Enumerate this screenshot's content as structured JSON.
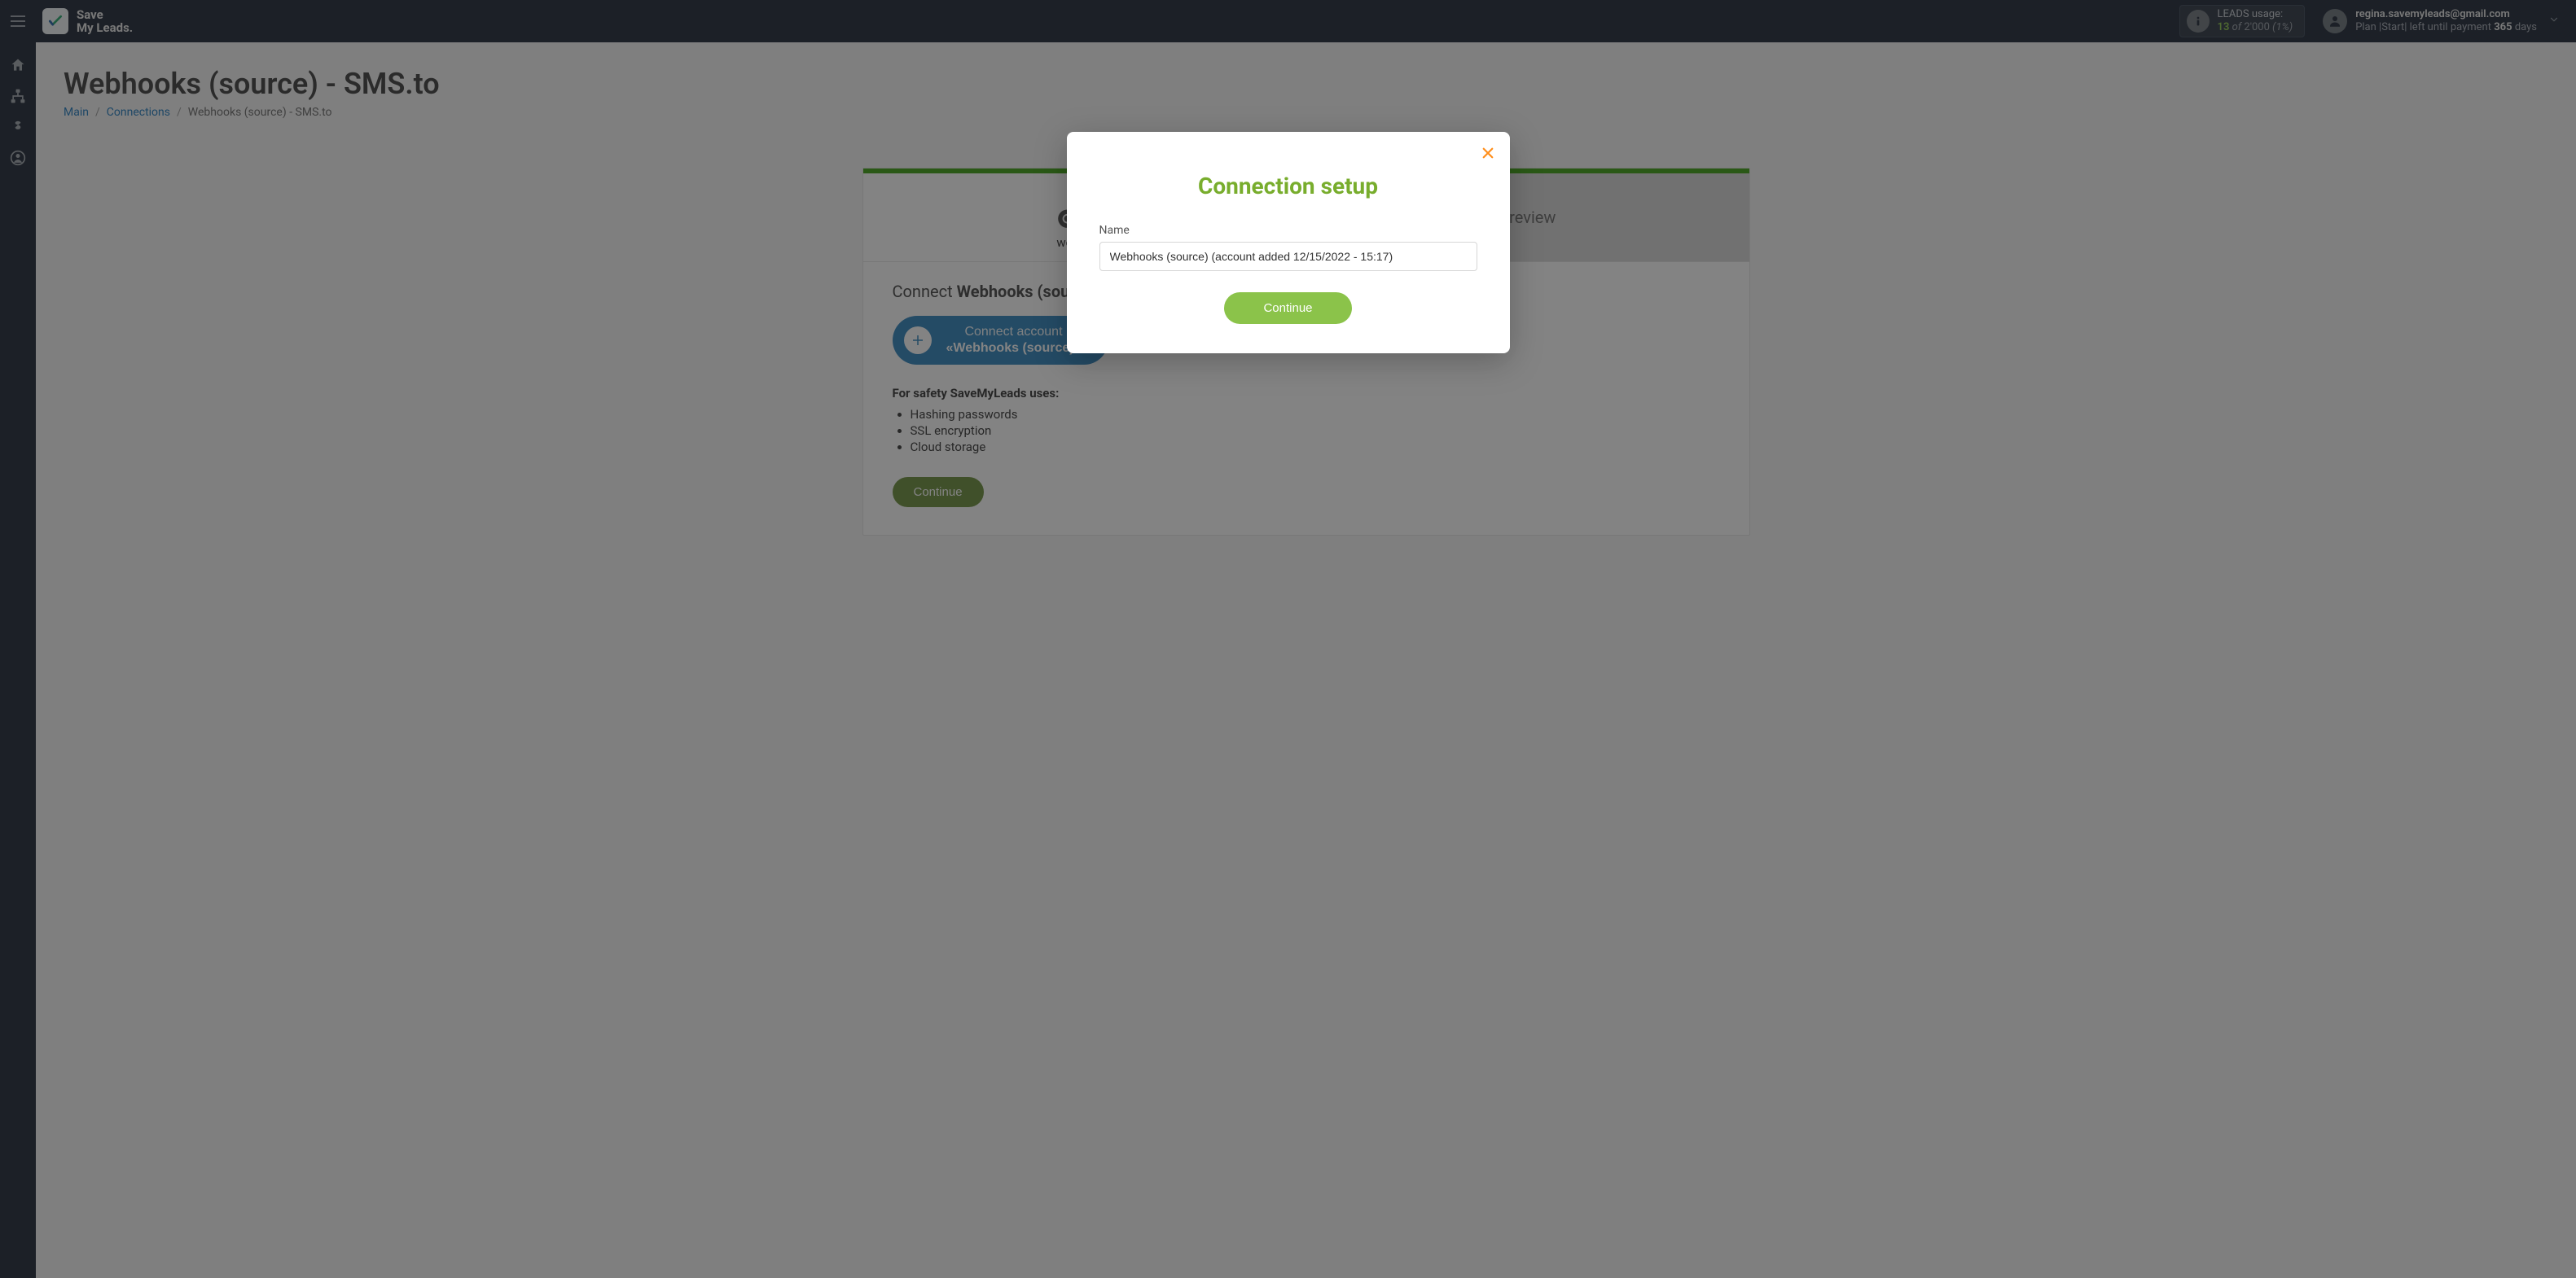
{
  "brand": {
    "line1": "Save",
    "line2": "My Leads."
  },
  "leads": {
    "label": "LEADS usage:",
    "count": "13",
    "of": "of",
    "total": "2'000",
    "pct": "(1%)"
  },
  "user": {
    "email": "regina.savemyleads@gmail.com",
    "plan_prefix": "Plan |Start| left until payment ",
    "days": "365",
    "days_suffix": " days"
  },
  "page": {
    "title": "Webhooks (source) - SMS.to",
    "breadcrumbs": {
      "main": "Main",
      "connections": "Connections",
      "current": "Webhooks (source) - SMS.to"
    }
  },
  "tabs": {
    "source_logo_word": "webhooks",
    "preview": "Preview"
  },
  "body": {
    "connect_prefix": "Connect ",
    "connect_target": "Webhooks (source)",
    "connect_btn_line1": "Connect account",
    "connect_btn_line2": "«Webhooks (source)»",
    "safety_heading": "For safety SaveMyLeads uses:",
    "safety_items": [
      "Hashing passwords",
      "SSL encryption",
      "Cloud storage"
    ],
    "continue": "Continue"
  },
  "modal": {
    "title": "Connection setup",
    "name_label": "Name",
    "name_value": "Webhooks (source) (account added 12/15/2022 - 15:17)",
    "continue": "Continue"
  }
}
